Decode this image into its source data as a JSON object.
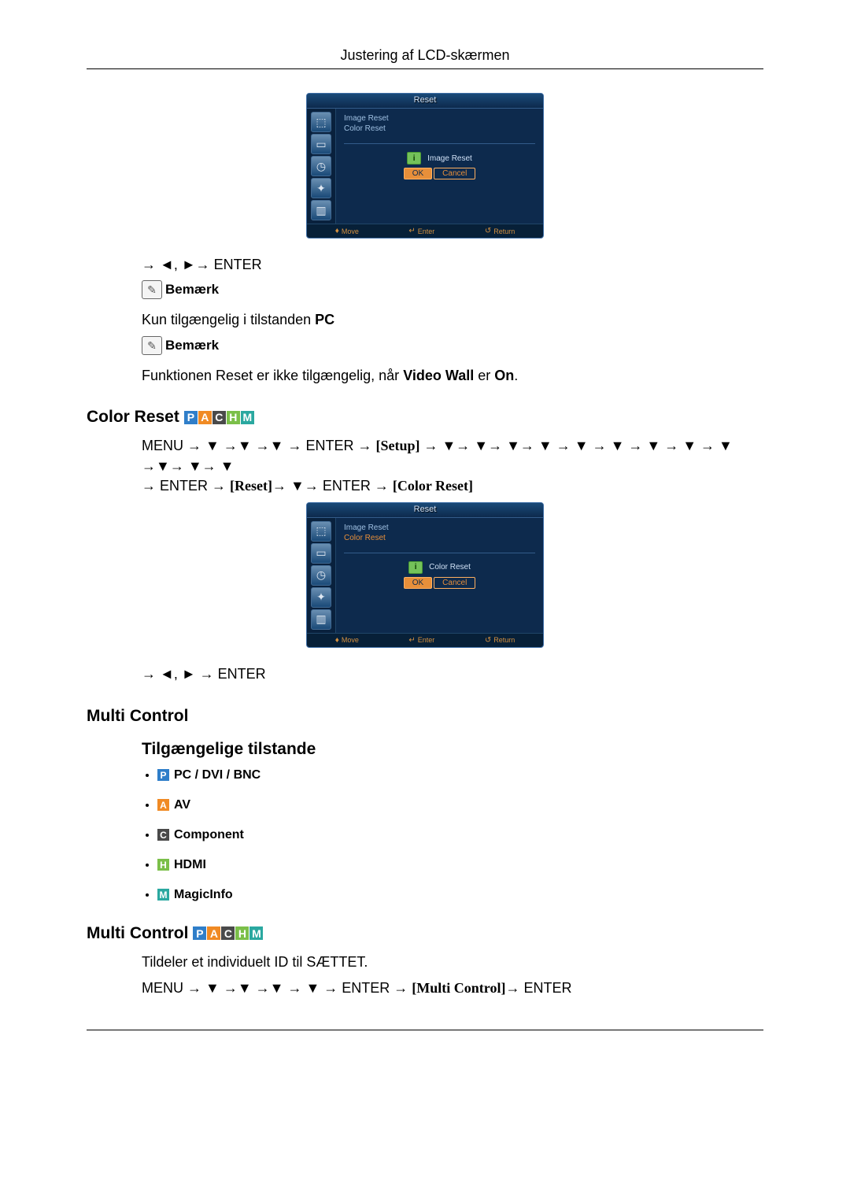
{
  "header": {
    "title": "Justering af LCD-skærmen"
  },
  "osd_common": {
    "title": "Reset",
    "menu_image_reset": "Image Reset",
    "menu_color_reset": "Color Reset",
    "btn_ok": "OK",
    "btn_cancel": "Cancel",
    "foot_move": "Move",
    "foot_enter": "Enter",
    "foot_return": "Return"
  },
  "osd1": {
    "dialog_label": "Image Reset"
  },
  "osd2": {
    "dialog_label": "Color Reset"
  },
  "nav1": {
    "line": "→ ◄, ►→ ENTER"
  },
  "note_label": "Bemærk",
  "note1_text_prefix": "Kun tilgængelig i tilstanden ",
  "note1_text_bold": "PC",
  "note2_text_prefix": "Funktionen Reset er ikke tilgængelig, når ",
  "note2_text_bold1": "Video Wall",
  "note2_text_mid": " er ",
  "note2_text_bold2": "On",
  "note2_text_suffix": ".",
  "section_color_reset": "Color Reset",
  "color_reset_path": {
    "menu": "MENU → ▼ →▼ →▼ → ENTER → ",
    "setup": "Setup",
    "mid1": " → ▼→ ▼→ ▼→ ▼ → ▼ → ▼ → ▼ → ▼ → ▼ →▼→ ▼→ ▼",
    "line2_pre": "→ ENTER → ",
    "reset": "Reset",
    "line2_mid": "→ ▼→ ENTER → ",
    "colorreset": "Color Reset"
  },
  "nav2": {
    "line": "→ ◄, ► → ENTER"
  },
  "section_multi_control": "Multi Control",
  "section_avail_modes": "Tilgængelige tilstande",
  "modes": {
    "p": "PC / DVI / BNC",
    "a": "AV",
    "c": "Component",
    "h": "HDMI",
    "m": "MagicInfo"
  },
  "section_multi_control2": "Multi Control",
  "mc_desc": "Tildeler et individuelt ID til SÆTTET.",
  "mc_path": {
    "menu": "MENU → ▼ →▼ →▼ → ▼ → ENTER → ",
    "mc": "Multi Control",
    "tail": "→ ENTER"
  }
}
